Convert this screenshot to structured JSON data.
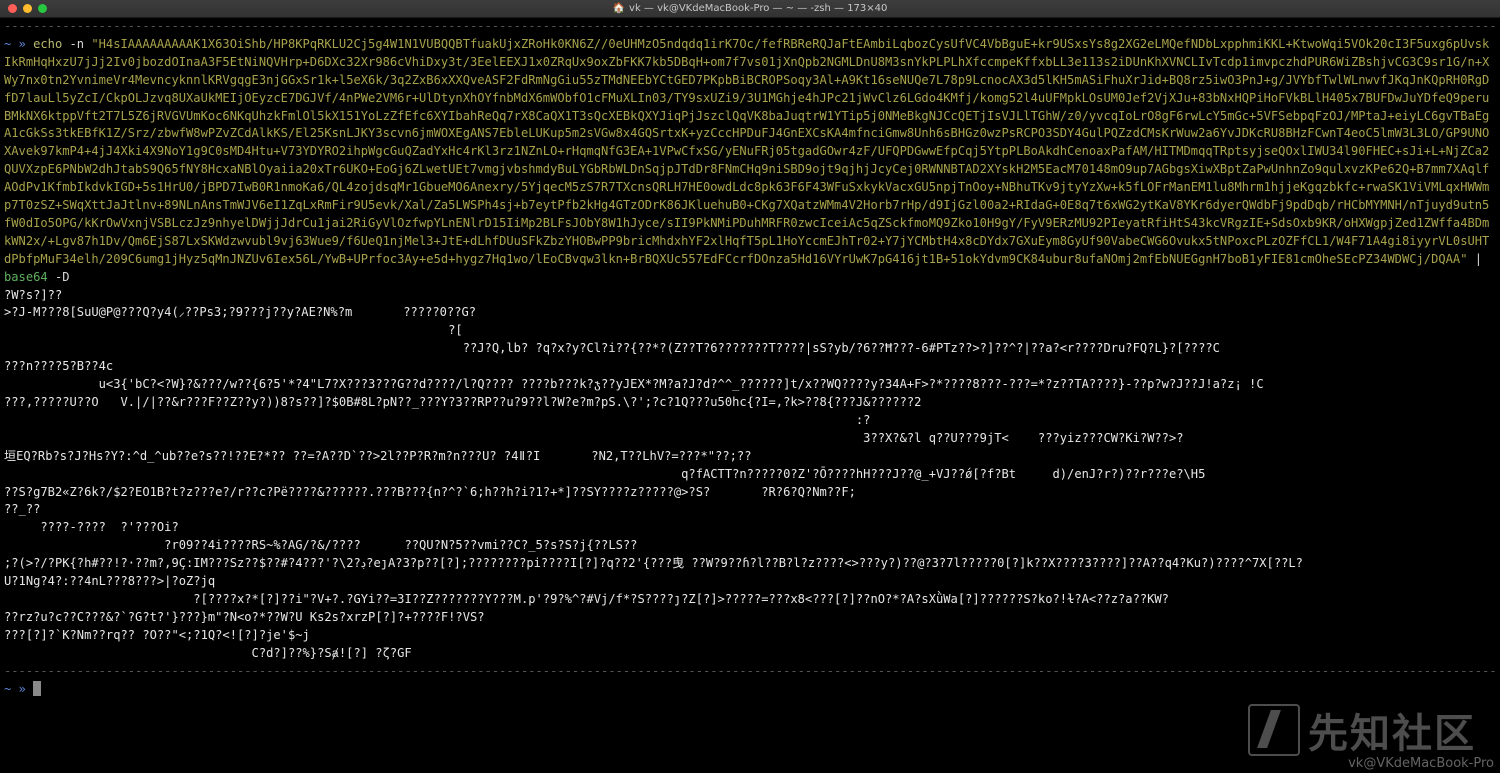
{
  "window": {
    "title": "vk — vk@VKdeMacBook-Pro — ~ — -zsh — 173×40",
    "folder_icon": "folder-icon"
  },
  "terminal": {
    "separator": "----------------------------------------------------------------------------------------------------------------------------------------------------------------------------------------------------------------------------------------------------",
    "prompt": "~ » ",
    "command": "echo",
    "flag": "-n",
    "echo_arg": "\"H4sIAAAAAAAAAK1X63OiShb/HP8KPqRKLU2Cj5g4W1N1VUBQQBTfuakUjxZRoHk0KN6Z//0eUHMzO5ndqdq1irK7Oc/fefRBReRQJaFtEAmbiLqbozCysUfVC4VbBguE+kr9USxsYs8g2XG2eLMQefNDbLxpphmiKKL+KtwoWqi5VOk20cI3F5uxg6pUvskIkRmHqHxzU7jJj2Iv0jbozdOInaA3F5EtNiNQVHrp+D6DXc32Xr986cVhiDxy3t/3EelEEXJ1x0ZRqUx9oxZbFKK7kb5DBqH+om7f7vs01jXnQpb2NGMLDnU8M3snYkPLPLhXfccmpeKffxbLL3e113s2iDUnKhXVNCLIvTcdp1imvpczhdPUR6WiZBshjvCG3C9sr1G/n+XWy7nx0tn2YvnimeVr4MevncyknnlKRVgqgE3njGGxSr1k+l5eX6k/3q2ZxB6xXXQveASF2FdRmNgGiu55zTMdNEEbYCtGED7PKpbBiBCROPSoqy3Al+A9Kt16seNUQe7L78p9LcnocAX3d5lKH5mASiFhuXrJid+BQ8rz5iwO3PnJ+g/JVYbfTwlWLnwvfJKqJnKQpRH0RgDfD7lauLl5yZcI/CkpOLJzvq8UXaUkMEIjOEyzcE7DGJVf/4nPWe2VM6r+UlDtynXhOYfnbMdX6mWObfO1cFMuXLIn03/TY9sxUZi9/3U1MGhje4hJPc21jWvClz6LGdo4KMfj/komg52l4uUFMpkLOsUM0Jef2VjXJu+83bNxHQPiHoFVkBLlH405x7BUFDwJuYDfeQ9peruBMkNX6ktppVft2T7L5Z6jRVGVUmKoc6NKqUhzkFmlOl5kX151YoLzZfEfc6XYIbahReQq7rX8CaQX1T3sQcXEBkQXYJiqPjJszclQqVK8baJuqtrW1YTip5j0NMeBkgNJCcQETjIsVJLlTGhW/z0/yvcqIoLrO8gF6rwLcY5mGc+5VFSebpqFzOJ/MPtaJ+eiyLC6gvTBaEgA1cGkSs3tkEBfK1Z/Srz/zbwfW8wPZvZCdAlkKS/El25KsnLJKY3scvn6jmWOXEgANS7EbleLUKup5m2sVGw8x4GQSrtxK+yzCccHPDuFJ4GnEXCsKA4mfnciGmw8Unh6sBHGz0wzPsRCPO3SDY4GulPQZzdCMsKrWuw2a6YvJDKcRU8BHzFCwnT4eoC5lmW3L3LO/GP9UNOXAvek97kmP4+4jJ4Xki4X9NoY1g9C0sMD4Htu+V73YDYRO2ihpWgcGuQZadYxHc4rKl3rz1NZnLO+rHqmqNfG3EA+1VPwCfxSG/yENuFRj05tgadGOwr4zF/UFQPDGwwEfpCqj5YtpPLBoAkdhCenoaxPafAM/HITMDmqqTRptsyjseQOxlIWU34l90FHEC+sJi+L+NjZCa2QUVXzpE6PNbW2dhJtabS9Q65fNY8HcxaNBlOyaiia20xTr6UKO+EoGj6ZLwetUEt7vmgjvbshmdyBuLYGbRbWLDnSqjpJTdDr8FNmCHq9niSBD9ojt9qjhjJcyCej0RWNNBTAD2XYskH2M5EacM70148mO9up7AGbgsXiwXBptZaPwUnhnZo9qulxvzKPe62Q+B7mm7XAqlfAOdPv1KfmbIkdvkIGD+5s1HrU0/jBPD7IwB0R1nmoKa6/QL4zojdsqMr1GbueMO6Anexry/5YjqecM5zS7R7TXcnsQRLH7HE0owdLdc8pk63F6F43WFuSxkykVacxGU5npjTnOoy+NBhuTKv9jtyYzXw+k5fLOFrManEM1lu8Mhrm1hjjeKgqzbkfc+rwaSK1ViVMLqxHWWmp7T0zSZ+SWqXttJaJtlnv+89NLnAnsTmWJV6eI1ZqLxRmFir9U5evk/Xal/Za5LWSPh4sj+b7eytPfb2kHg4GTzODrK86JKluehuB0+CKg7XQatzWMm4V2Horb7rHp/d9IjGzl00a2+RIdaG+0E8q7t6xWG2ytKaV8YKr6dyerQWdbFj9pdDqb/rHCbMYMNH/nTjuyd9utn5fW0dIo5OPG/kKrOwVxnjVSBLczJz9nhyelDWjjJdrCu1jai2RiGyVlOzfwpYLnENlrD15IiMp2BLFsJObY8W1hJyce/sII9PkNMiPDuhMRFR0zwcIceiAc5qZSckfmoMQ9Zko10H9gY/FyV9ERzMU92PIeyatRfiHtS43kcVRgzIE+SdsOxb9KR/oHXWgpjZed1ZWffa4BDmkWN2x/+Lgv87h1Dv/Qm6EjS87LxSKWdzwvubl9vj63Wue9/f6UeQ1njMel3+JtE+dLhfDUuSFkZbzYHOBwPP9bricMhdxhYF2xlHqfT5pL1HoYccmEJhTr02+Y7jYCMbtH4x8cDYdx7GXuEym8GyUf90VabeCWG6Ovukx5tNPoxcPLzOZFfCL1/W4F71A4gi8iyyrVL0sUHTdPbfpMuF34elh/209C6umg1jHyz5qMnJNZUv6Iex56L/YwB+UPrfoc3Ay+e5d+hygz7Hq1wo/lEoCBvqw3lkn+BrBQXUc557EdFCcrfDOnza5Hd16VYrUwK7pG416jt1B+51okYdvm9CK84ubur8ufaNOmj2mfEbNUEGgnH7boB1yFIE81cmOheSEcPZ34WDWCj/DQAA\"",
    "pipe": "|",
    "decoder": "base64",
    "decoder_flag": "-D",
    "output_lines": [
      "?W?s?]??",
      ">?J-M???8[SuU@P@???Q?y4(⸝??Ps3;?9???j??y?AE?N%?m       ?????0??G?",
      "                                                             ?[",
      "                                                               ??J?Q,lb? ?q?x?y?Cl?i??{??*?(Z??T?6???????T????|sS?yb/?6??Ħ???-6#PTz??>?]??^?|??a?<r????Dru?FQ?L}?[????C",
      "???n????5?B??4c",
      "             u<3{'bC?<?W}?&???/w??{6?5'*?4\"L7?X???3???G??d????/l?Q???? ????b???k?ჯ??yJEX*?M?a?J?d?^^_??????]t/x??WQ????y?34A+F>?*????8???-???=*?z??TA????}-??p?w?J??J!a?z¡ !C",
      "???,?????U??O   V.|/|??&r???F??Z??y?))8?s??]?$0B#8L?pN??_???Y?3??RP??u?9??l?W?e?m?pS.\\?';?c?1Q???u50hc{?I=,?k>??8{???J&??????2",
      "                                                                                                                     :?",
      "                                                                                                                      3??X?&?l q??U???9jT<    ???yiz???CW?Ki?W??>?",
      "垣EQ?Rb?s?J?Hs?Y?:^d_^ub??e?s??!??E?*?? ??=?A??D`??>2l??P?R?m?n???U? ?4ǁ?I       ?N2,T??LhV?=???*\"??;??",
      "                                                                                             q?fACTT?n?????0?Z'?Ō????hH???J??@_+VJ??ǿ[?f?Bt     d)/enJ?r?)??r???e?\\H5",
      "??S?g7B2«Z?6k?/$2?EO1B?t?z???e?/r??c?Pë????&??????.???B???{n?^?`6;h??h?i?1?+*]??SY????z?????@>?S?       ?R?6?Q?Nm??F;",
      "??_??",
      "     ????-????  ?'???Oi?",
      "                      ?r09??4i????RS~%?AG/?&/????      ??QU?N?5??vmi??C?_5?s?S?j{??LS??",
      ";?(>?/?PK{?h#??!?·??m?,9Ç:IM???Sz??$??#?4???'?\\2?ڊ?eȷA?3?p??[?];????????pi????I[?]?q??2'{???曳 ??W?9??ɦ?l??B?l?z????<>???y?)??@?3?7l?????0[?]k??X????3????]??A??q4?Ku?)????^7X[??L?",
      "U?1Ng?4?:??4nL???8???>|?oZ?jq",
      "                          ?[????x?*[?]??i\"?V+?.?GYi??=3I??Z???????Y???M.p'?9?%^?#Vj/f*?S????ȷ?Z[?]>?????=???x8<???[?]??nO?*?A?sXǜWa[?]??????S?ko?!ɫ?A<??z?a??KW?",
      "??rz?u?c??C???&?`?G?t?'}???}m\"?N<o?*??W?U Ks2s?xrzP[?]?+????F!?VS?",
      "???[?]?`K?Nm??rq?? ?O??\"<;?1Q?<![?]?je'$~j",
      "                                  C?d?]??%}?Sⱥ![?] ?ζ?GF"
    ],
    "final_prompt": "~ » "
  },
  "watermark": {
    "brand": "先知社区",
    "sub": "vk@VKdeMacBook-Pro"
  }
}
